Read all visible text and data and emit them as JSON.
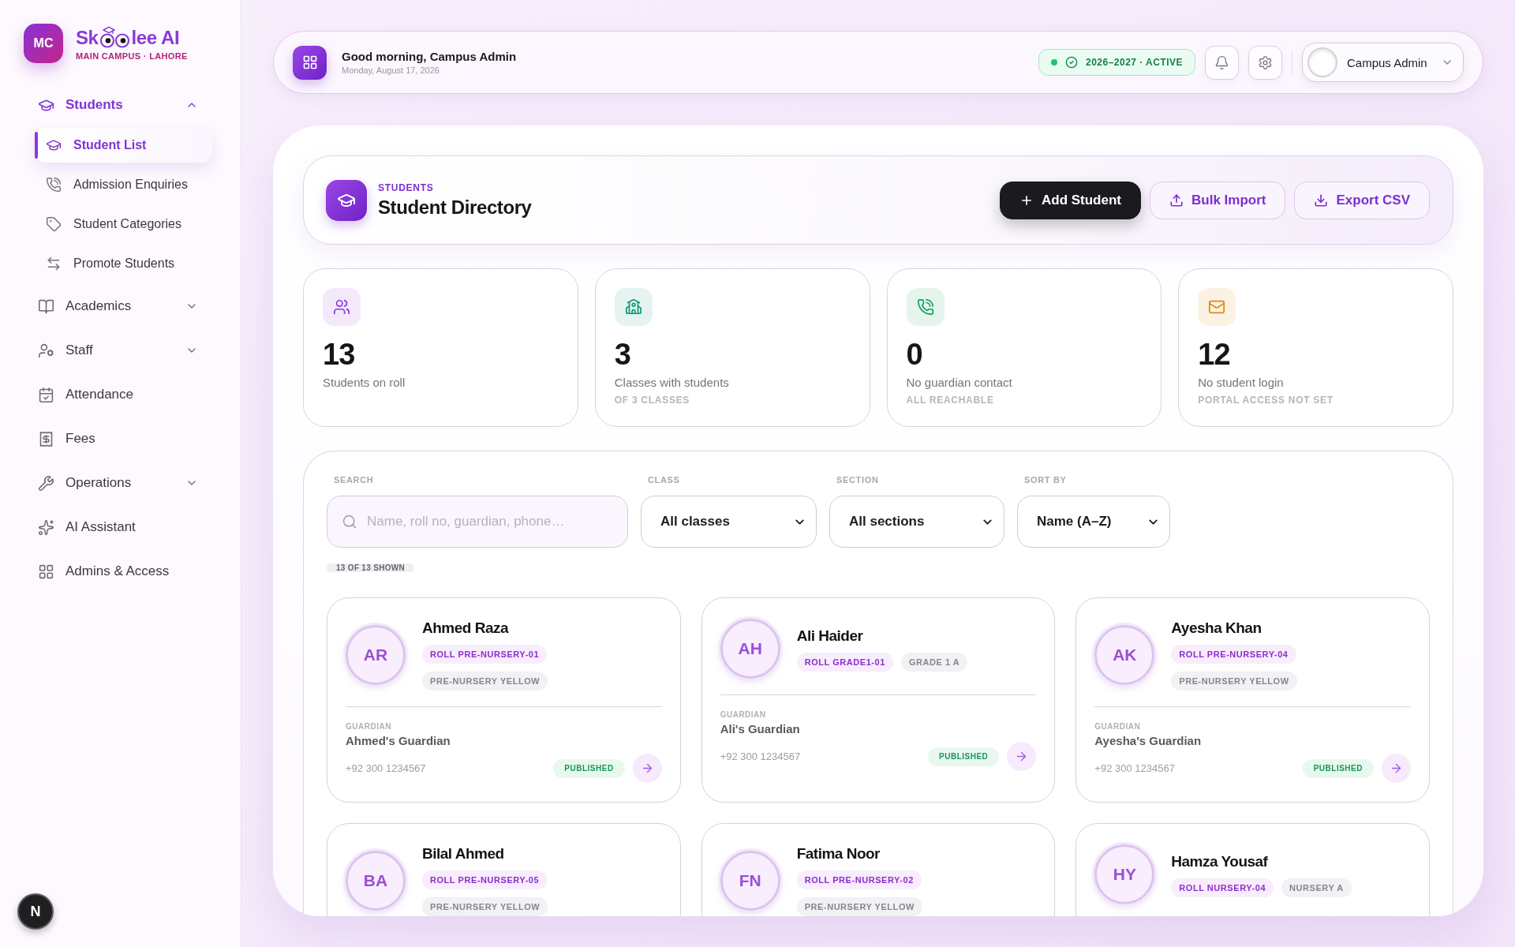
{
  "sidebar": {
    "brand": {
      "avatar": "MC",
      "name_start": "Sk",
      "name_end": "lee AI",
      "subtitle": "MAIN CAMPUS · LAHORE"
    },
    "nav": [
      {
        "label": "Students",
        "kind": "group",
        "expanded": true,
        "selected": false,
        "children": [
          {
            "label": "Student List",
            "selected": true
          },
          {
            "label": "Admission Enquiries",
            "selected": false
          },
          {
            "label": "Student Categories",
            "selected": false
          },
          {
            "label": "Promote Students",
            "selected": false
          }
        ]
      },
      {
        "label": "Academics",
        "kind": "group",
        "expanded": false,
        "selected": false
      },
      {
        "label": "Staff",
        "kind": "group",
        "expanded": false,
        "selected": false
      },
      {
        "label": "Attendance",
        "kind": "link",
        "selected": false
      },
      {
        "label": "Fees",
        "kind": "link",
        "selected": false
      },
      {
        "label": "Operations",
        "kind": "group",
        "expanded": false,
        "selected": false
      },
      {
        "label": "AI Assistant",
        "kind": "link",
        "selected": false
      },
      {
        "label": "Admins & Access",
        "kind": "link",
        "selected": false
      }
    ]
  },
  "dev_badge": {
    "label": "N"
  },
  "top_bar": {
    "greeting": "Good morning, Campus Admin",
    "date": "Monday, August 17, 2026",
    "session": "2026–2027 · ACTIVE",
    "user": "Campus Admin"
  },
  "page_header": {
    "eyebrow": "STUDENTS",
    "title": "Student Directory",
    "actions": [
      {
        "label": "Add Student",
        "kind": "primary"
      },
      {
        "label": "Bulk Import",
        "kind": "secondary"
      },
      {
        "label": "Export CSV",
        "kind": "secondary"
      }
    ]
  },
  "stats": [
    {
      "value": "13",
      "label": "Students on roll",
      "color": "#8b3bd9"
    },
    {
      "value": "3",
      "label": "Classes with students",
      "note": "OF 3 CLASSES",
      "color": "#0f9a7a"
    },
    {
      "value": "0",
      "label": "No guardian contact",
      "note": "ALL REACHABLE",
      "color": "#12a05c"
    },
    {
      "value": "12",
      "label": "No student login",
      "note": "PORTAL ACCESS NOT SET",
      "color": "#e08a0b"
    }
  ],
  "filters": [
    {
      "kind": "search",
      "label": "SEARCH",
      "placeholder": "Name, roll no, guardian, phone…"
    },
    {
      "kind": "select",
      "label": "CLASS",
      "value": "All classes"
    },
    {
      "kind": "select",
      "label": "SECTION",
      "value": "All sections"
    },
    {
      "kind": "select",
      "label": "SORT BY",
      "value": "Name (A–Z)"
    }
  ],
  "result_count": "13 OF 13 SHOWN",
  "students": [
    {
      "initials": "AR",
      "name": "Ahmed Raza",
      "roll": "ROLL PRE-NURSERY-01",
      "class": "PRE-NURSERY YELLOW",
      "guardian_label": "GUARDIAN",
      "guardian": "Ahmed's Guardian",
      "phone": "+92 300 1234567",
      "status": "PUBLISHED"
    },
    {
      "initials": "AH",
      "name": "Ali Haider",
      "roll": "ROLL GRADE1-01",
      "class": "GRADE 1 A",
      "guardian_label": "GUARDIAN",
      "guardian": "Ali's Guardian",
      "phone": "+92 300 1234567",
      "status": "PUBLISHED"
    },
    {
      "initials": "AK",
      "name": "Ayesha Khan",
      "roll": "ROLL PRE-NURSERY-04",
      "class": "PRE-NURSERY YELLOW",
      "guardian_label": "GUARDIAN",
      "guardian": "Ayesha's Guardian",
      "phone": "+92 300 1234567",
      "status": "PUBLISHED"
    },
    {
      "initials": "BA",
      "name": "Bilal Ahmed",
      "roll": "ROLL PRE-NURSERY-05",
      "class": "PRE-NURSERY YELLOW"
    },
    {
      "initials": "FN",
      "name": "Fatima Noor",
      "roll": "ROLL PRE-NURSERY-02",
      "class": "PRE-NURSERY YELLOW"
    },
    {
      "initials": "HY",
      "name": "Hamza Yousaf",
      "roll": "ROLL NURSERY-04",
      "class": "NURSERY A"
    }
  ]
}
